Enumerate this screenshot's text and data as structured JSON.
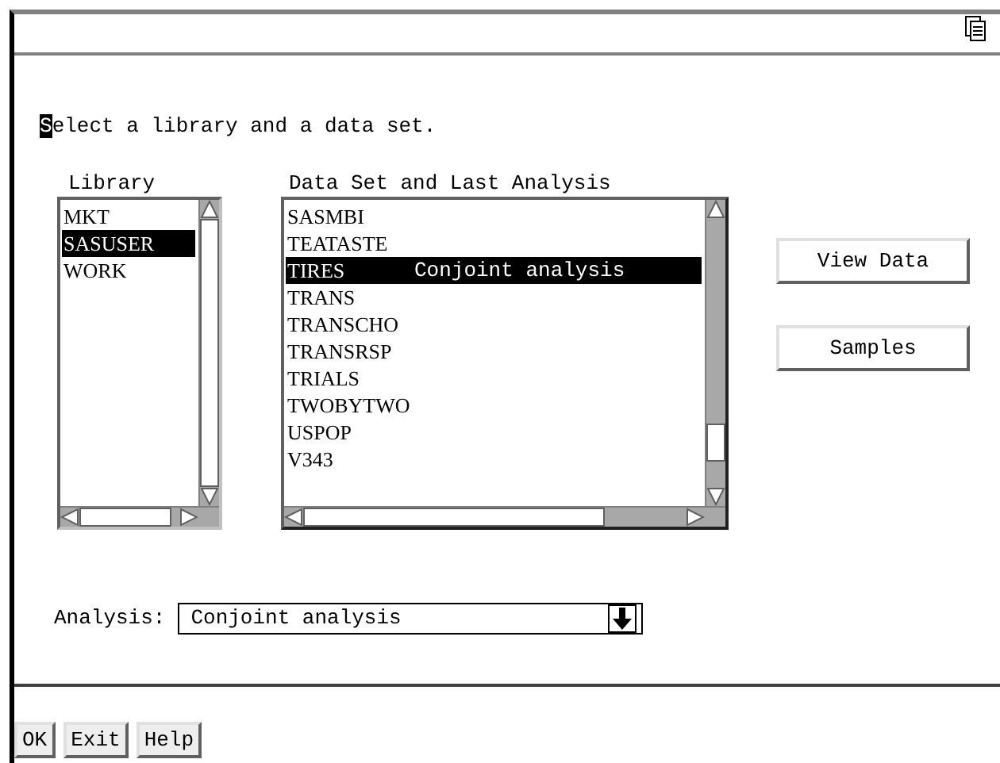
{
  "prompt": {
    "text": "Select a library and a data set.",
    "cursor": true
  },
  "library": {
    "label": "Library",
    "items": [
      {
        "name": "MKT",
        "selected": false
      },
      {
        "name": "SASUSER",
        "selected": true
      },
      {
        "name": "WORK",
        "selected": false
      }
    ]
  },
  "data_sets": {
    "label": "Data Set and Last Analysis",
    "items": [
      {
        "name": "SASMBI",
        "selected": false
      },
      {
        "name": "TEATASTE",
        "selected": false
      },
      {
        "name": "TIRES",
        "analysis": "Conjoint analysis",
        "selected": true
      },
      {
        "name": "TRANS",
        "selected": false
      },
      {
        "name": "TRANSCHO",
        "selected": false
      },
      {
        "name": "TRANSRSP",
        "selected": false
      },
      {
        "name": "TRIALS",
        "selected": false
      },
      {
        "name": "TWOBYTWO",
        "selected": false
      },
      {
        "name": "USPOP",
        "selected": false
      },
      {
        "name": "V343",
        "selected": false
      }
    ]
  },
  "side_buttons": [
    "View Data",
    "Samples"
  ],
  "analysis": {
    "label": "Analysis:",
    "value": "Conjoint analysis"
  },
  "bottom_buttons": [
    "OK",
    "Exit",
    "Help"
  ]
}
